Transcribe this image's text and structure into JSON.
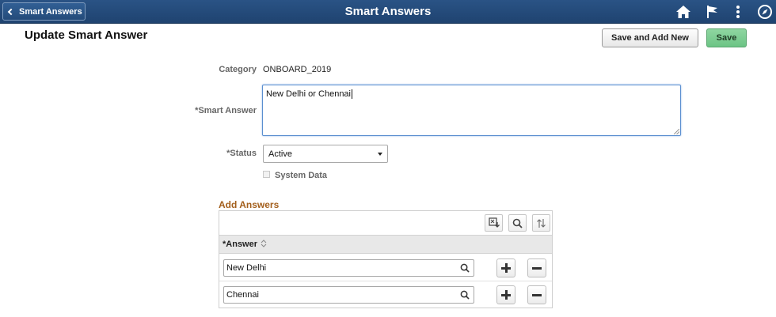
{
  "header": {
    "back_label": "Smart Answers",
    "title": "Smart Answers",
    "icons": [
      "home-icon",
      "flag-icon",
      "more-vertical-icon",
      "compass-icon"
    ]
  },
  "page": {
    "title": "Update Smart Answer",
    "save_and_add_new_label": "Save and Add New",
    "save_label": "Save"
  },
  "form": {
    "category_label": "Category",
    "category_value": "ONBOARD_2019",
    "smart_answer_required": "*",
    "smart_answer_label": "Smart Answer",
    "smart_answer_value": "New Delhi or Chennai",
    "status_required": "*",
    "status_label": "Status",
    "status_value": "Active",
    "system_data_label": "System Data",
    "system_data_checked": false
  },
  "answers": {
    "section_title": "Add Answers",
    "toolbar_icons": [
      "export-icon",
      "search-icon",
      "sort-icon"
    ],
    "column_required": "*",
    "column_header": "Answer",
    "rows": [
      {
        "value": "New Delhi"
      },
      {
        "value": "Chennai"
      }
    ]
  },
  "colors": {
    "header_bg": "#1f4370",
    "save_green": "#6cc485",
    "section_title": "#a35f1c",
    "focus_border": "#5b8fd0"
  }
}
